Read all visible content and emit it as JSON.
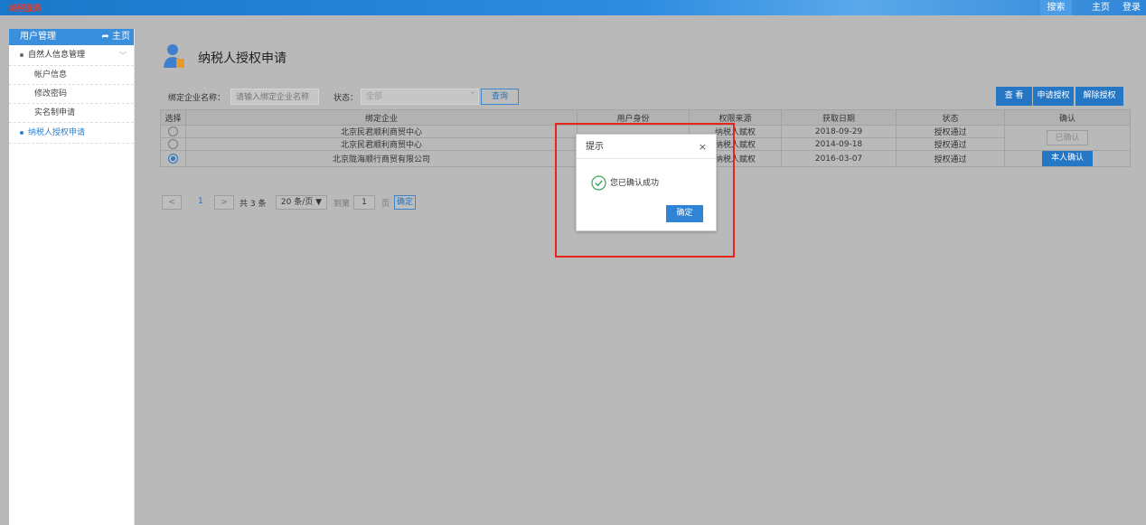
{
  "topbar": {
    "logo": "纳税服务",
    "search_label": "搜索",
    "home_label": "主页",
    "login_label": "登录"
  },
  "sidebar": {
    "title": "用户管理",
    "home_link": "主页",
    "group_personal": "自然人信息管理",
    "items": [
      "帐户信息",
      "修改密码",
      "实名制申请"
    ],
    "group_authorize": "纳税人授权申请"
  },
  "page": {
    "title": "纳税人授权申请"
  },
  "filter": {
    "company_label": "绑定企业名称：",
    "company_placeholder": "请输入绑定企业名称",
    "status_label": "状态：",
    "status_value": "全部",
    "query_button": "查询"
  },
  "actions": {
    "view": "查 看",
    "apply": "申请授权",
    "revoke": "解除授权"
  },
  "table": {
    "headers": [
      "选择",
      "绑定企业",
      "用户身份",
      "权限来源",
      "获取日期",
      "状态",
      "确认"
    ],
    "rows": [
      {
        "company": "北京民君顺利商贸中心",
        "identity": "",
        "source": "纳税人赋权",
        "date": "2018-09-29",
        "status": "授权通过",
        "selected": false
      },
      {
        "company": "北京民君顺利商贸中心",
        "identity": "",
        "source": "纳税人赋权",
        "date": "2014-09-18",
        "status": "授权通过",
        "selected": false
      },
      {
        "company": "北京陇海顺行商贸有限公司",
        "identity": "",
        "source": "纳税人赋权",
        "date": "2016-03-07",
        "status": "授权通过",
        "selected": true
      }
    ],
    "confirmed_label": "已确认",
    "self_confirm_label": "本人确认"
  },
  "pager": {
    "prev": "<",
    "current_page": "1",
    "next": ">",
    "total": "共 3 条",
    "page_size": "20 条/页 ▼",
    "goto_label": "到第",
    "goto_value": "1",
    "page_suffix": "页",
    "confirm": "确定"
  },
  "dialog": {
    "title": "提示",
    "close": "×",
    "message": "您已确认成功",
    "ok": "确定"
  },
  "colors": {
    "primary": "#2577c6",
    "highlight": "#e5251b"
  }
}
